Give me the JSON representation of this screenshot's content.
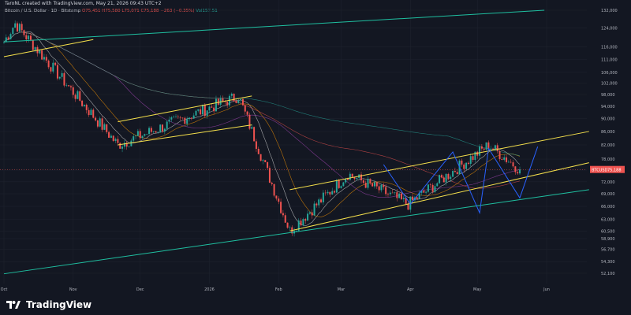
{
  "header": {
    "author_line": "TaroNL created with TradingView.com, May 21, 2026 09:43 UTC+2",
    "symbol": "Bitcoin / U.S. Dollar · 1D · Bitstamp",
    "o": "O75,451",
    "h": "H75,580",
    "l": "L75,071",
    "c": "C75,188",
    "change": "−263 (−0.35%)",
    "vol": "Vol157.51"
  },
  "price_label": {
    "symbol": "BTCUSD",
    "value": "75,188"
  },
  "logo_text": "TradingView",
  "colors": {
    "background": "#131722",
    "up": "#26a69a",
    "down": "#ef5350",
    "channel": "#f5e04c",
    "support": "#1fbfa0",
    "path": "#2962ff"
  },
  "chart_data": {
    "type": "candlestick",
    "y_ticks": [
      52100,
      54300,
      56700,
      58900,
      60500,
      63000,
      66000,
      69000,
      72000,
      75000,
      78000,
      82000,
      86000,
      90000,
      94000,
      98000,
      102000,
      106000,
      111000,
      116000,
      124000,
      132000
    ],
    "y_tick_labels": [
      "52,100",
      "54,300",
      "56,700",
      "58,900",
      "60,500",
      "63,000",
      "66,000",
      "69,000",
      "72,000",
      "75,000",
      "78,000",
      "82,000",
      "86,000",
      "90,000",
      "94,000",
      "98,000",
      "102,000",
      "106,000",
      "111,000",
      "116,000",
      "124,000",
      "132,000"
    ],
    "x_tick_labels": [
      "Oct",
      "Nov",
      "Dec",
      "2026",
      "Feb",
      "Mar",
      "Apr",
      "May",
      "Jun"
    ],
    "last_price": 75188,
    "key_prices": [
      {
        "date": "2025-10-06",
        "price": 126000
      },
      {
        "date": "2025-11-21",
        "price": 82000
      },
      {
        "date": "2026-01-14",
        "price": 97500
      },
      {
        "date": "2026-02-06",
        "price": 60500
      },
      {
        "date": "2026-03-04",
        "price": 74000
      },
      {
        "date": "2026-03-31",
        "price": 66500
      },
      {
        "date": "2026-05-06",
        "price": 82000
      },
      {
        "date": "2026-05-20",
        "price": 75188
      }
    ]
  }
}
